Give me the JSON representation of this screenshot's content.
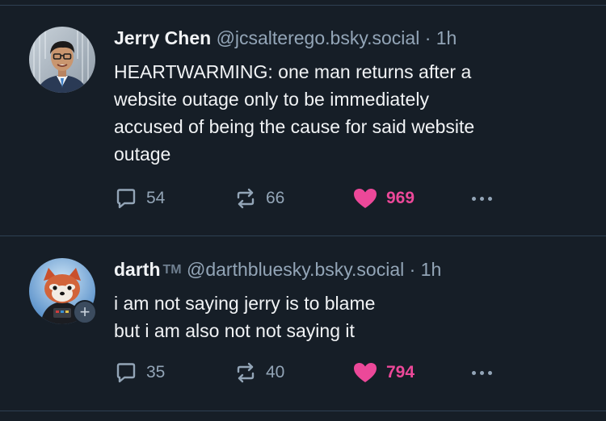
{
  "posts": [
    {
      "author_name": "Jerry Chen",
      "author_handle": "@jcsalterego.bsky.social",
      "separator": "·",
      "time": "1h",
      "text": "HEARTWARMING: one man returns after a\nwebsite outage only to be immediately\naccused of being the cause for said website\noutage",
      "replies": "54",
      "reposts": "66",
      "likes": "969",
      "liked": true
    },
    {
      "author_name": "darth",
      "author_suffix": "TM",
      "author_handle": "@darthbluesky.bsky.social",
      "separator": "·",
      "time": "1h",
      "text": "i am not saying jerry is to blame\nbut i am also not not saying it",
      "replies": "35",
      "reposts": "40",
      "likes": "794",
      "liked": true,
      "follow_badge": "+"
    }
  ],
  "colors": {
    "background": "#161e27",
    "divider": "#2e4052",
    "text_primary": "#f1f3f5",
    "text_secondary": "#93a5b7",
    "like_pink": "#ec4899"
  },
  "icons": {
    "reply": "reply-icon",
    "repost": "repost-icon",
    "like": "heart-icon",
    "more": "more-dots-icon"
  }
}
